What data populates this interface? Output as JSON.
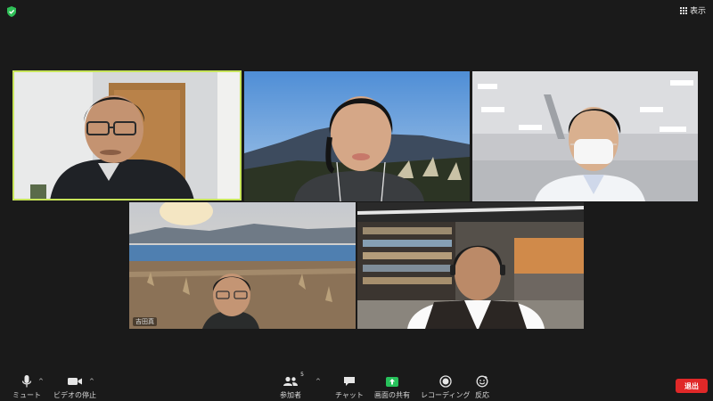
{
  "header": {
    "view_label": "表示"
  },
  "icons": {
    "shield": "shield-check-icon",
    "view": "grid-view-icon",
    "mic": "microphone-icon",
    "video": "video-camera-icon",
    "participants": "participants-icon",
    "chat": "chat-bubble-icon",
    "share": "share-screen-icon",
    "record": "record-icon",
    "reactions": "emoji-reaction-icon"
  },
  "colors": {
    "background": "#1a1a1a",
    "active_speaker_border": "#c7e45a",
    "share_green": "#27c15b",
    "leave_red": "#e02828"
  },
  "tiles": [
    {
      "id": "speaker-1"
    },
    {
      "id": "speaker-2"
    },
    {
      "id": "speaker-3"
    },
    {
      "id": "speaker-4",
      "label": "吉田真"
    },
    {
      "id": "speaker-5"
    }
  ],
  "toolbar": {
    "mute_label": "ミュート",
    "video_label": "ビデオの停止",
    "participants_label": "参加者",
    "participants_count": "5",
    "chat_label": "チャット",
    "share_label": "画面の共有",
    "record_label": "レコーディング",
    "reactions_label": "反応",
    "leave_label": "退出",
    "caret": "^"
  }
}
